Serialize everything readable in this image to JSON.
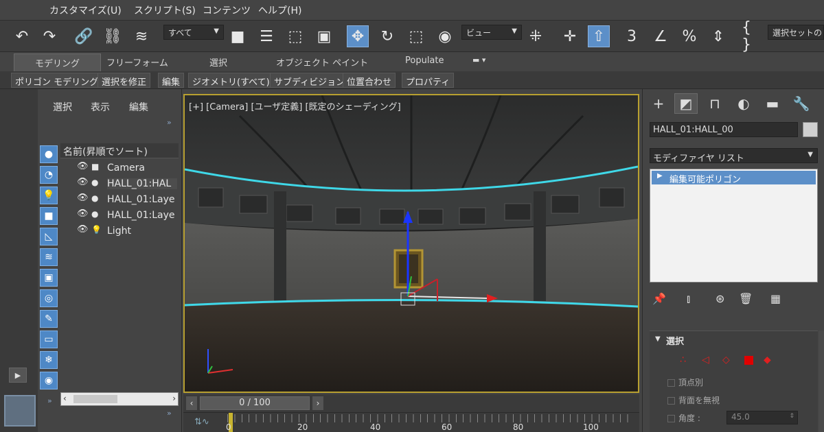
{
  "menu": {
    "items": [
      "カスタマイズ(U)",
      "スクリプト(S)",
      "コンテンツ",
      "ヘルプ(H)"
    ]
  },
  "toolbar": {
    "filter_value": "すべて",
    "view_value": "ビュー",
    "selset_label": "選択セットの"
  },
  "ribbon": {
    "tabs": [
      "モデリング",
      "フリーフォーム",
      "選択",
      "オブジェクト ペイント",
      "Populate"
    ],
    "sub": [
      "ポリゴン モデリング",
      "選択を修正",
      "編集",
      "ジオメトリ(すべて)",
      "サブディビジョン",
      "位置合わせ",
      "プロパティ"
    ]
  },
  "scene_explorer": {
    "menu": [
      "選択",
      "表示",
      "編集"
    ],
    "header": "名前(昇順でソート)",
    "rows": [
      "Camera",
      "HALL_01:HAL",
      "HALL_01:Laye",
      "HALL_01:Laye",
      "Light"
    ]
  },
  "viewport": {
    "label": "[+] [Camera] [ユーザ定義] [既定のシェーディング]"
  },
  "timeline": {
    "frame": "0 / 100",
    "ticks": [
      "0",
      "20",
      "40",
      "60",
      "80",
      "100"
    ]
  },
  "command_panel": {
    "object_name": "HALL_01:HALL_00",
    "modifier_list": "モディファイヤ リスト",
    "stack_item": "編集可能ポリゴン",
    "rollout_title": "選択",
    "options": [
      "頂点別",
      "背面を無視",
      "角度 :"
    ],
    "angle_value": "45.0"
  },
  "colors": {
    "accent": "#5c8fc8",
    "viewport_border": "#b8a030",
    "edge_highlight": "#3fd8e8"
  }
}
